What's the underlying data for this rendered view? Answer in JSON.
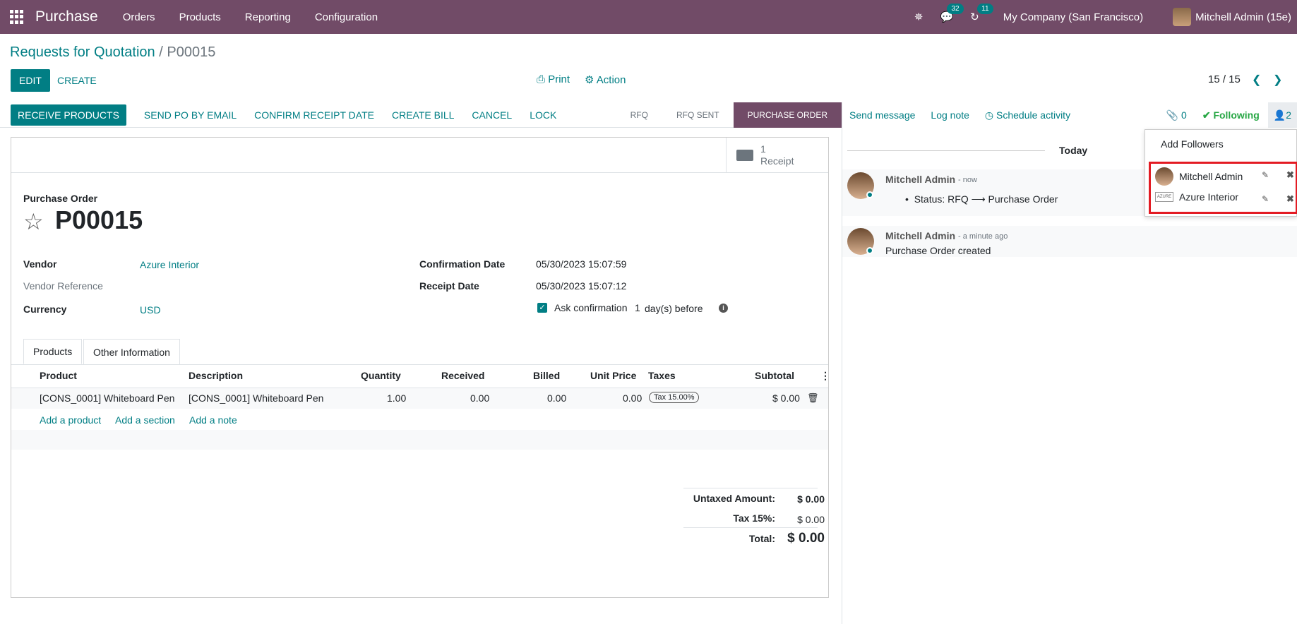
{
  "navbar": {
    "app_name": "Purchase",
    "menu": [
      "Orders",
      "Products",
      "Reporting",
      "Configuration"
    ],
    "messages_count": "32",
    "activities_count": "11",
    "company": "My Company (San Francisco)",
    "user": "Mitchell Admin (15e)"
  },
  "breadcrumb": {
    "parent": "Requests for Quotation",
    "separator": "/",
    "current": "P00015"
  },
  "controls": {
    "edit": "EDIT",
    "create": "CREATE",
    "print": "Print",
    "action": "Action",
    "pager": "15 / 15"
  },
  "statusbar": {
    "buttons": [
      "RECEIVE PRODUCTS",
      "SEND PO BY EMAIL",
      "CONFIRM RECEIPT DATE",
      "CREATE BILL",
      "CANCEL",
      "LOCK"
    ],
    "stages": [
      "RFQ",
      "RFQ SENT",
      "PURCHASE ORDER"
    ],
    "active_stage": "PURCHASE ORDER"
  },
  "smart_button": {
    "count": "1",
    "label": "Receipt"
  },
  "form": {
    "doc_type": "Purchase Order",
    "name": "P00015",
    "vendor_label": "Vendor",
    "vendor": "Azure Interior",
    "vendor_ref_label": "Vendor Reference",
    "currency_label": "Currency",
    "currency": "USD",
    "confirmation_label": "Confirmation Date",
    "confirmation_date": "05/30/2023 15:07:59",
    "receipt_label": "Receipt Date",
    "receipt_date": "05/30/2023 15:07:12",
    "ask_confirmation_label": "Ask confirmation",
    "ask_confirmation_days": "1",
    "ask_confirmation_suffix": "day(s) before",
    "ask_confirmation_checked": true
  },
  "tabs": [
    "Products",
    "Other Information"
  ],
  "table": {
    "headers": {
      "product": "Product",
      "description": "Description",
      "quantity": "Quantity",
      "received": "Received",
      "billed": "Billed",
      "unit_price": "Unit Price",
      "taxes": "Taxes",
      "subtotal": "Subtotal"
    },
    "rows": [
      {
        "product": "[CONS_0001] Whiteboard Pen",
        "description": "[CONS_0001] Whiteboard Pen",
        "quantity": "1.00",
        "received": "0.00",
        "billed": "0.00",
        "unit_price": "0.00",
        "taxes": "Tax 15.00%",
        "subtotal": "$ 0.00"
      }
    ],
    "add_product": "Add a product",
    "add_section": "Add a section",
    "add_note": "Add a note"
  },
  "totals": {
    "untaxed_label": "Untaxed Amount:",
    "untaxed": "$ 0.00",
    "tax_label": "Tax 15%:",
    "tax": "$ 0.00",
    "total_label": "Total:",
    "total": "$ 0.00"
  },
  "chatter": {
    "send_message": "Send message",
    "log_note": "Log note",
    "schedule_activity": "Schedule activity",
    "attachments": "0",
    "following": "Following",
    "followers_count": "2",
    "today": "Today",
    "messages": [
      {
        "author": "Mitchell Admin",
        "time": "- now",
        "body": "Status: RFQ ⟶ Purchase Order"
      },
      {
        "author": "Mitchell Admin",
        "time": "- a minute ago",
        "body": "Purchase Order created"
      }
    ]
  },
  "followers_dropdown": {
    "add": "Add Followers",
    "followers": [
      "Mitchell Admin",
      "Azure Interior"
    ],
    "logo_text": "AZURE"
  }
}
